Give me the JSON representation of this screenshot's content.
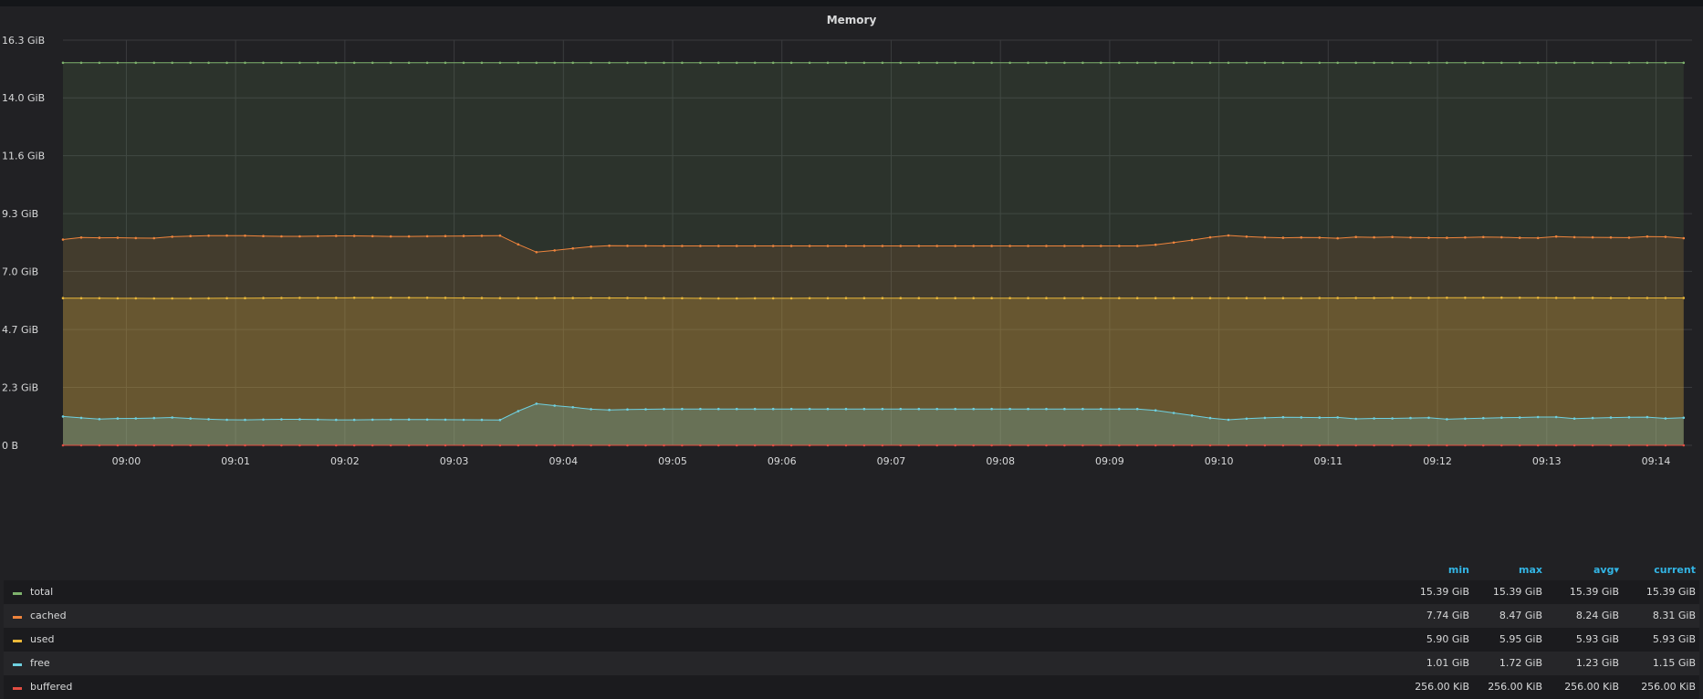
{
  "panel": {
    "title": "Memory"
  },
  "legend": {
    "headers": {
      "min": "min",
      "max": "max",
      "avg": "avg▾",
      "current": "current"
    }
  },
  "chart_data": {
    "type": "area",
    "title": "Memory",
    "y_ticks": [
      "0 B",
      "2.3 GiB",
      "4.7 GiB",
      "7.0 GiB",
      "9.3 GiB",
      "11.6 GiB",
      "14.0 GiB",
      "16.3 GiB"
    ],
    "y_tick_values": [
      0,
      2.33,
      4.66,
      7.0,
      9.32,
      11.65,
      13.98,
      16.3
    ],
    "ylim": [
      0,
      16.3
    ],
    "y_unit": "GiB",
    "x_ticks": [
      "09:00",
      "09:01",
      "09:02",
      "09:03",
      "09:04",
      "09:05",
      "09:06",
      "09:07",
      "09:08",
      "09:09",
      "09:10",
      "09:11",
      "09:12",
      "09:13",
      "09:14"
    ],
    "x_range_minutes": [
      -0.58,
      14.33
    ],
    "grid": true,
    "legend_placement": "bottom",
    "series": [
      {
        "name": "total",
        "color": "#7eb26d",
        "min": "15.39 GiB",
        "max": "15.39 GiB",
        "avg": "15.39 GiB",
        "current": "15.39 GiB",
        "points": [
          [
            -0.58,
            15.39
          ],
          [
            14.33,
            15.39
          ]
        ]
      },
      {
        "name": "cached",
        "color": "#ef843c",
        "min": "7.74 GiB",
        "max": "8.47 GiB",
        "avg": "8.24 GiB",
        "current": "8.31 GiB",
        "points": [
          [
            -0.58,
            8.28
          ],
          [
            -0.33,
            8.4
          ],
          [
            -0.17,
            8.3
          ],
          [
            0.0,
            8.4
          ],
          [
            0.17,
            8.28
          ],
          [
            0.33,
            8.38
          ],
          [
            0.67,
            8.43
          ],
          [
            1.0,
            8.44
          ],
          [
            1.5,
            8.4
          ],
          [
            2.0,
            8.43
          ],
          [
            2.5,
            8.4
          ],
          [
            3.0,
            8.42
          ],
          [
            3.5,
            8.44
          ],
          [
            3.67,
            7.74
          ],
          [
            3.83,
            7.8
          ],
          [
            4.17,
            7.96
          ],
          [
            4.33,
            8.03
          ],
          [
            5.0,
            8.02
          ],
          [
            6.0,
            8.02
          ],
          [
            7.0,
            8.02
          ],
          [
            8.0,
            8.02
          ],
          [
            9.33,
            8.02
          ],
          [
            9.67,
            8.2
          ],
          [
            10.0,
            8.42
          ],
          [
            10.17,
            8.47
          ],
          [
            10.33,
            8.33
          ],
          [
            10.5,
            8.4
          ],
          [
            10.67,
            8.3
          ],
          [
            10.83,
            8.42
          ],
          [
            11.0,
            8.3
          ],
          [
            11.17,
            8.36
          ],
          [
            11.33,
            8.4
          ],
          [
            11.5,
            8.34
          ],
          [
            11.67,
            8.42
          ],
          [
            11.83,
            8.3
          ],
          [
            12.0,
            8.4
          ],
          [
            12.17,
            8.3
          ],
          [
            12.33,
            8.42
          ],
          [
            12.5,
            8.34
          ],
          [
            12.67,
            8.4
          ],
          [
            12.83,
            8.3
          ],
          [
            13.0,
            8.38
          ],
          [
            13.17,
            8.42
          ],
          [
            13.33,
            8.33
          ],
          [
            13.5,
            8.4
          ],
          [
            13.67,
            8.33
          ],
          [
            13.83,
            8.38
          ],
          [
            14.0,
            8.42
          ],
          [
            14.17,
            8.36
          ],
          [
            14.33,
            8.31
          ]
        ]
      },
      {
        "name": "used",
        "color": "#eab839",
        "min": "5.90 GiB",
        "max": "5.95 GiB",
        "avg": "5.93 GiB",
        "current": "5.93 GiB",
        "points": [
          [
            -0.58,
            5.92
          ],
          [
            0.5,
            5.91
          ],
          [
            1.5,
            5.93
          ],
          [
            2.5,
            5.94
          ],
          [
            3.5,
            5.92
          ],
          [
            4.5,
            5.93
          ],
          [
            5.5,
            5.91
          ],
          [
            6.5,
            5.92
          ],
          [
            7.5,
            5.92
          ],
          [
            8.5,
            5.92
          ],
          [
            9.5,
            5.92
          ],
          [
            10.5,
            5.92
          ],
          [
            11.5,
            5.93
          ],
          [
            12.5,
            5.94
          ],
          [
            13.5,
            5.93
          ],
          [
            14.33,
            5.93
          ]
        ]
      },
      {
        "name": "free",
        "color": "#6ed0e0",
        "min": "1.01 GiB",
        "max": "1.72 GiB",
        "avg": "1.23 GiB",
        "current": "1.15 GiB",
        "points": [
          [
            -0.58,
            1.16
          ],
          [
            -0.33,
            1.08
          ],
          [
            -0.17,
            1.03
          ],
          [
            0.0,
            1.12
          ],
          [
            0.17,
            1.05
          ],
          [
            0.33,
            1.14
          ],
          [
            0.67,
            1.06
          ],
          [
            1.0,
            1.02
          ],
          [
            1.5,
            1.05
          ],
          [
            2.0,
            1.02
          ],
          [
            2.5,
            1.04
          ],
          [
            3.0,
            1.03
          ],
          [
            3.5,
            1.02
          ],
          [
            3.67,
            1.72
          ],
          [
            3.83,
            1.63
          ],
          [
            4.17,
            1.5
          ],
          [
            4.33,
            1.41
          ],
          [
            4.5,
            1.44
          ],
          [
            5.0,
            1.46
          ],
          [
            6.0,
            1.46
          ],
          [
            7.0,
            1.46
          ],
          [
            8.0,
            1.46
          ],
          [
            9.33,
            1.46
          ],
          [
            9.67,
            1.25
          ],
          [
            10.0,
            1.05
          ],
          [
            10.17,
            1.01
          ],
          [
            10.33,
            1.13
          ],
          [
            10.5,
            1.08
          ],
          [
            10.67,
            1.18
          ],
          [
            10.83,
            1.07
          ],
          [
            11.0,
            1.16
          ],
          [
            11.17,
            1.09
          ],
          [
            11.33,
            1.04
          ],
          [
            11.5,
            1.12
          ],
          [
            11.67,
            1.05
          ],
          [
            11.83,
            1.14
          ],
          [
            12.0,
            1.08
          ],
          [
            12.17,
            1.02
          ],
          [
            12.33,
            1.12
          ],
          [
            12.5,
            1.07
          ],
          [
            12.67,
            1.15
          ],
          [
            12.83,
            1.09
          ],
          [
            13.0,
            1.18
          ],
          [
            13.17,
            1.1
          ],
          [
            13.33,
            1.05
          ],
          [
            13.5,
            1.14
          ],
          [
            13.67,
            1.09
          ],
          [
            13.83,
            1.16
          ],
          [
            14.0,
            1.11
          ],
          [
            14.17,
            1.06
          ],
          [
            14.33,
            1.15
          ]
        ]
      },
      {
        "name": "buffered",
        "color": "#e24d42",
        "min": "256.00 KiB",
        "max": "256.00 KiB",
        "avg": "256.00 KiB",
        "current": "256.00 KiB",
        "points": [
          [
            -0.58,
            0.0002
          ],
          [
            14.33,
            0.0002
          ]
        ]
      }
    ]
  }
}
